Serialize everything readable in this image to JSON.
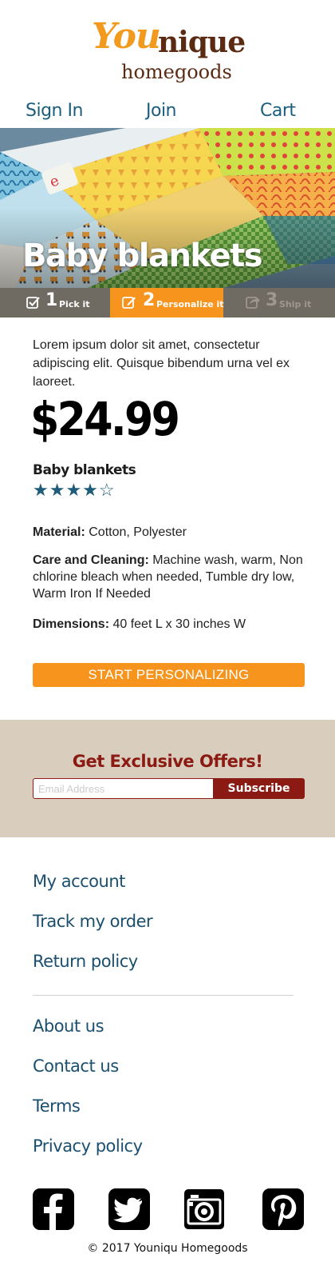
{
  "brand": {
    "part1": "You",
    "part2": "nique",
    "part3": "homegoods"
  },
  "nav": {
    "signin": "Sign In",
    "join": "Join",
    "cart": "Cart"
  },
  "hero": {
    "title": "Baby blankets"
  },
  "steps": [
    {
      "num": "1",
      "label": "Pick it"
    },
    {
      "num": "2",
      "label": "Personalize it"
    },
    {
      "num": "3",
      "label": "Ship it"
    }
  ],
  "product": {
    "description": "Lorem ipsum dolor sit amet, consectetur adipiscing elit. Quisque bibendum urna vel ex laoreet.",
    "price": "$24.99",
    "name": "Baby blankets",
    "rating_stars": "★★★★☆",
    "rating": 4,
    "rating_max": 5,
    "material_label": "Material:",
    "material_value": "Cotton, Polyester",
    "care_label": "Care and Cleaning:",
    "care_value": "Machine wash, warm, Non chlorine bleach when needed, Tumble dry low, Warm Iron If Needed",
    "dimensions_label": "Dimensions:",
    "dimensions_value": "40 feet L x 30 inches W"
  },
  "cta": {
    "label": "START PERSONALIZING"
  },
  "offers": {
    "heading": "Get Exclusive Offers!",
    "placeholder": "Email Address",
    "button": "Subscribe"
  },
  "footer": {
    "links1": [
      "My account",
      "Track my order",
      "Return policy"
    ],
    "links2": [
      "About us",
      "Contact us",
      "Terms",
      "Privacy policy"
    ],
    "social_icons": [
      "facebook-icon",
      "twitter-icon",
      "camera-icon",
      "pinterest-icon"
    ],
    "copyright": "© 2017 Youniqu Homegoods"
  },
  "colors": {
    "accent": "#f7941d",
    "brand_brown": "#5b2a12",
    "link": "#1a5e7e",
    "offer_red": "#8b1a12",
    "offer_bg": "#d9cebd",
    "step_bg": "#6f6a62"
  }
}
